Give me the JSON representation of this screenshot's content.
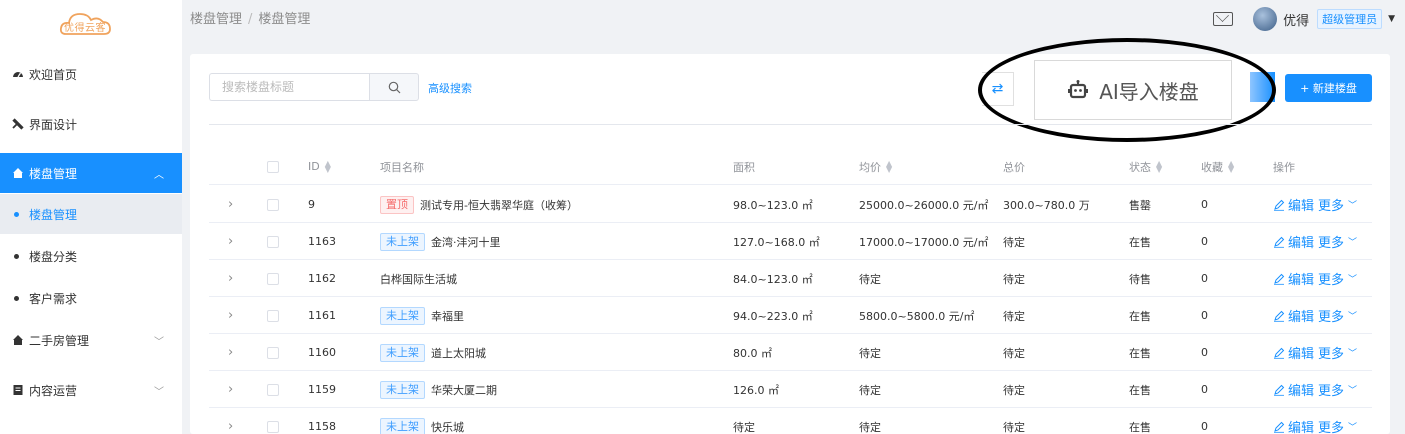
{
  "logo": {
    "text": "优得云客"
  },
  "sidebar": {
    "items": [
      {
        "label": "欢迎首页",
        "icon": "dashboard-icon"
      },
      {
        "label": "界面设计",
        "icon": "tools-icon"
      },
      {
        "label": "楼盘管理",
        "icon": "home-icon",
        "expanded": true,
        "active": true
      },
      {
        "label": "二手房管理",
        "icon": "home-icon"
      },
      {
        "label": "内容运营",
        "icon": "document-icon"
      }
    ],
    "subitems": [
      {
        "label": "楼盘管理",
        "current": true
      },
      {
        "label": "楼盘分类"
      },
      {
        "label": "客户需求"
      }
    ]
  },
  "breadcrumb": {
    "parent": "楼盘管理",
    "sep": "/",
    "current": "楼盘管理"
  },
  "topbar": {
    "username": "优得",
    "role": "超级管理员"
  },
  "toolbar": {
    "search_placeholder": "搜索楼盘标题",
    "advanced_search": "高级搜索",
    "ai_import": "AI导入楼盘",
    "new_button": "+ 新建楼盘"
  },
  "table": {
    "columns": {
      "id": "ID",
      "name": "项目名称",
      "area": "面积",
      "avg_price": "均价",
      "total_price": "总价",
      "status": "状态",
      "favorites": "收藏",
      "actions": "操作"
    },
    "rows": [
      {
        "id": "9",
        "tag": "置顶",
        "tag_type": "red",
        "name": "测试专用-恒大翡翠华庭（收筹）",
        "area": "98.0~123.0 ㎡",
        "avg": "25000.0~26000.0 元/㎡",
        "total": "300.0~780.0 万",
        "status": "售罄",
        "fav": "0"
      },
      {
        "id": "1163",
        "tag": "未上架",
        "tag_type": "blue",
        "name": "金湾·沣河十里",
        "area": "127.0~168.0 ㎡",
        "avg": "17000.0~17000.0 元/㎡",
        "total": "待定",
        "status": "在售",
        "fav": "0"
      },
      {
        "id": "1162",
        "tag": "",
        "tag_type": "",
        "name": "白桦国际生活城",
        "area": "84.0~123.0 ㎡",
        "avg": "待定",
        "total": "待定",
        "status": "待售",
        "fav": "0"
      },
      {
        "id": "1161",
        "tag": "未上架",
        "tag_type": "blue",
        "name": "幸福里",
        "area": "94.0~223.0 ㎡",
        "avg": "5800.0~5800.0 元/㎡",
        "total": "待定",
        "status": "在售",
        "fav": "0"
      },
      {
        "id": "1160",
        "tag": "未上架",
        "tag_type": "blue",
        "name": "道上太阳城",
        "area": "80.0 ㎡",
        "avg": "待定",
        "total": "待定",
        "status": "在售",
        "fav": "0"
      },
      {
        "id": "1159",
        "tag": "未上架",
        "tag_type": "blue",
        "name": "华荣大厦二期",
        "area": "126.0 ㎡",
        "avg": "待定",
        "total": "待定",
        "status": "在售",
        "fav": "0"
      },
      {
        "id": "1158",
        "tag": "未上架",
        "tag_type": "blue",
        "name": "快乐城",
        "area": "待定",
        "avg": "待定",
        "total": "待定",
        "status": "在售",
        "fav": "0"
      }
    ],
    "edit_label": "编辑",
    "more_label": "更多"
  }
}
